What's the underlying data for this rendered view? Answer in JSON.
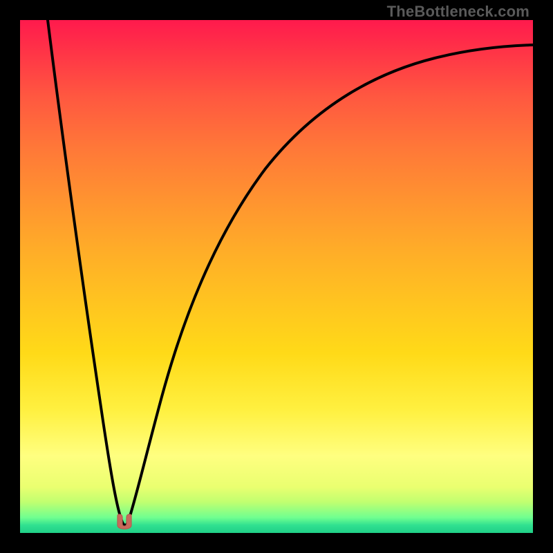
{
  "watermark": "TheBottleneck.com",
  "colors": {
    "frame": "#000000",
    "curve": "#000000",
    "marker_fill": "#c76b5c",
    "marker_stroke": "#b65c50"
  },
  "chart_data": {
    "type": "line",
    "title": "",
    "xlabel": "",
    "ylabel": "",
    "xlim": [
      0,
      100
    ],
    "ylim": [
      0,
      100
    ],
    "background_gradient": [
      {
        "pos": 0.0,
        "color": "#ff1a4d"
      },
      {
        "pos": 0.25,
        "color": "#ff7838"
      },
      {
        "pos": 0.55,
        "color": "#ffc420"
      },
      {
        "pos": 0.85,
        "color": "#ffff80"
      },
      {
        "pos": 1.0,
        "color": "#20d088"
      }
    ],
    "series": [
      {
        "name": "bottleneck-curve",
        "x": [
          0,
          4,
          8,
          12,
          15,
          17,
          19,
          20,
          21,
          22,
          24,
          26,
          30,
          35,
          42,
          50,
          60,
          72,
          85,
          100
        ],
        "y": [
          100,
          80,
          58,
          36,
          18,
          8,
          3,
          1,
          3,
          8,
          20,
          37,
          55,
          68,
          78,
          84,
          88,
          91,
          93,
          94
        ]
      }
    ],
    "annotations": [
      {
        "name": "optimal-marker",
        "shape": "u-lobe",
        "x": 20.3,
        "y": 0.8,
        "color": "#c76b5c"
      }
    ]
  }
}
